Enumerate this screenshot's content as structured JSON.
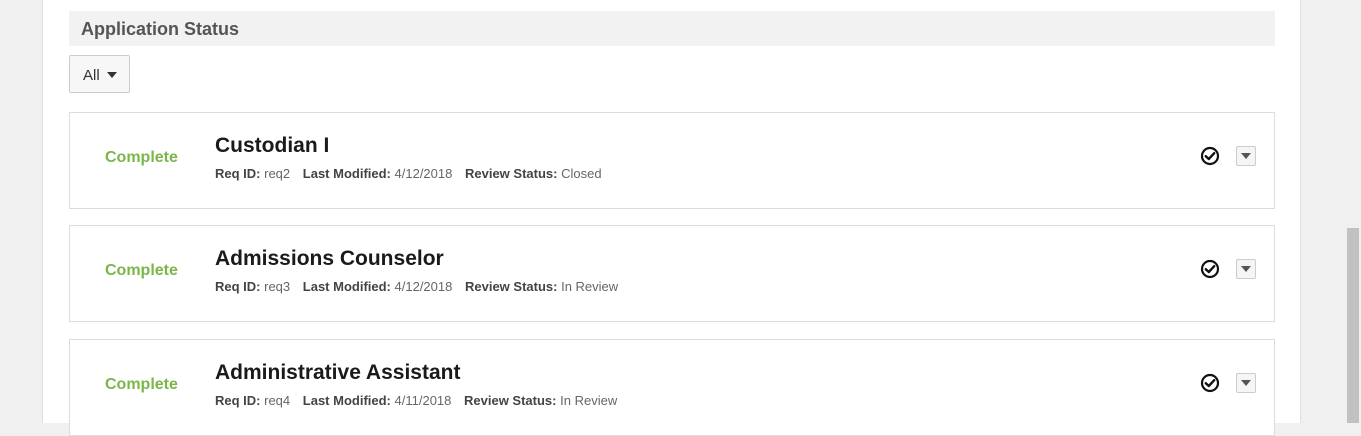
{
  "section": {
    "title": "Application Status"
  },
  "filter": {
    "selected": "All"
  },
  "applications": [
    {
      "status": "Complete",
      "title": "Custodian I",
      "req_id_label": "Req ID:",
      "req_id": "req2",
      "modified_label": "Last Modified:",
      "modified": "4/12/2018",
      "review_label": "Review Status:",
      "review": "Closed"
    },
    {
      "status": "Complete",
      "title": "Admissions Counselor",
      "req_id_label": "Req ID:",
      "req_id": "req3",
      "modified_label": "Last Modified:",
      "modified": "4/12/2018",
      "review_label": "Review Status:",
      "review": "In Review"
    },
    {
      "status": "Complete",
      "title": "Administrative Assistant",
      "req_id_label": "Req ID:",
      "req_id": "req4",
      "modified_label": "Last Modified:",
      "modified": "4/11/2018",
      "review_label": "Review Status:",
      "review": "In Review"
    }
  ],
  "colors": {
    "status_complete": "#7ab648",
    "header_bg": "#f2f2f2"
  },
  "icons": {
    "status": "check-circle-icon",
    "menu": "caret-down-icon"
  }
}
